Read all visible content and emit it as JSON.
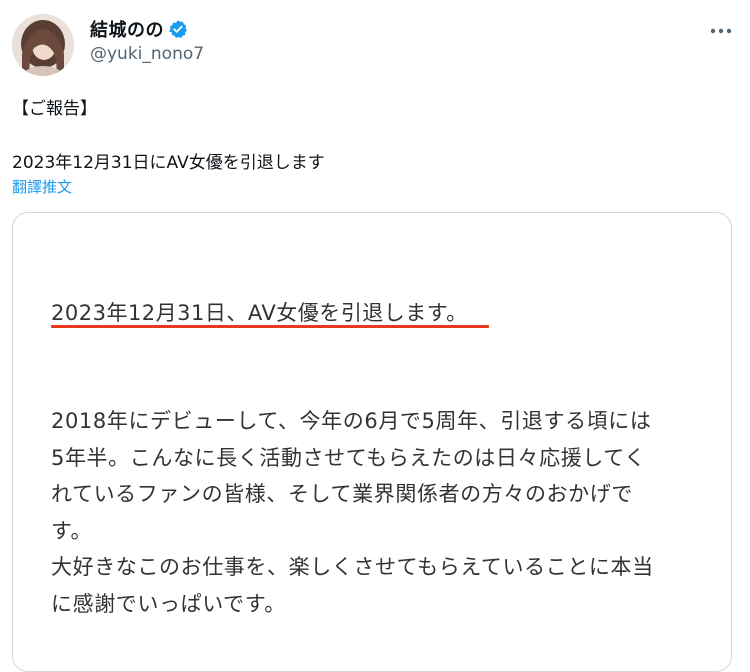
{
  "author": {
    "display_name": "結城のの",
    "handle": "@yuki_nono7",
    "verified_icon": "verified-badge-icon",
    "avatar_icon": "profile-avatar",
    "more_icon": "more-options-icon"
  },
  "tweet": {
    "line1": "【ご報告】",
    "line2": "2023年12月31日にAV女優を引退します",
    "translate_link": "翻譯推文"
  },
  "image_card": {
    "heading": "2023年12月31日、AV女優を引退します。",
    "underline_color": "#e8391f",
    "body_lines": [
      "2018年にデビューして、今年の6月で5周年、引退する頃には",
      "5年半。こんなに長く活動させてもらえたのは日々応援してく",
      "れているファンの皆様、そして業界関係者の方々のおかげで",
      "す。",
      "大好きなこのお仕事を、楽しくさせてもらえていることに本当",
      "に感謝でいっぱいです。"
    ]
  },
  "colors": {
    "link": "#1d9bf0",
    "secondary_text": "#536471",
    "card_border": "#cfd9de"
  }
}
